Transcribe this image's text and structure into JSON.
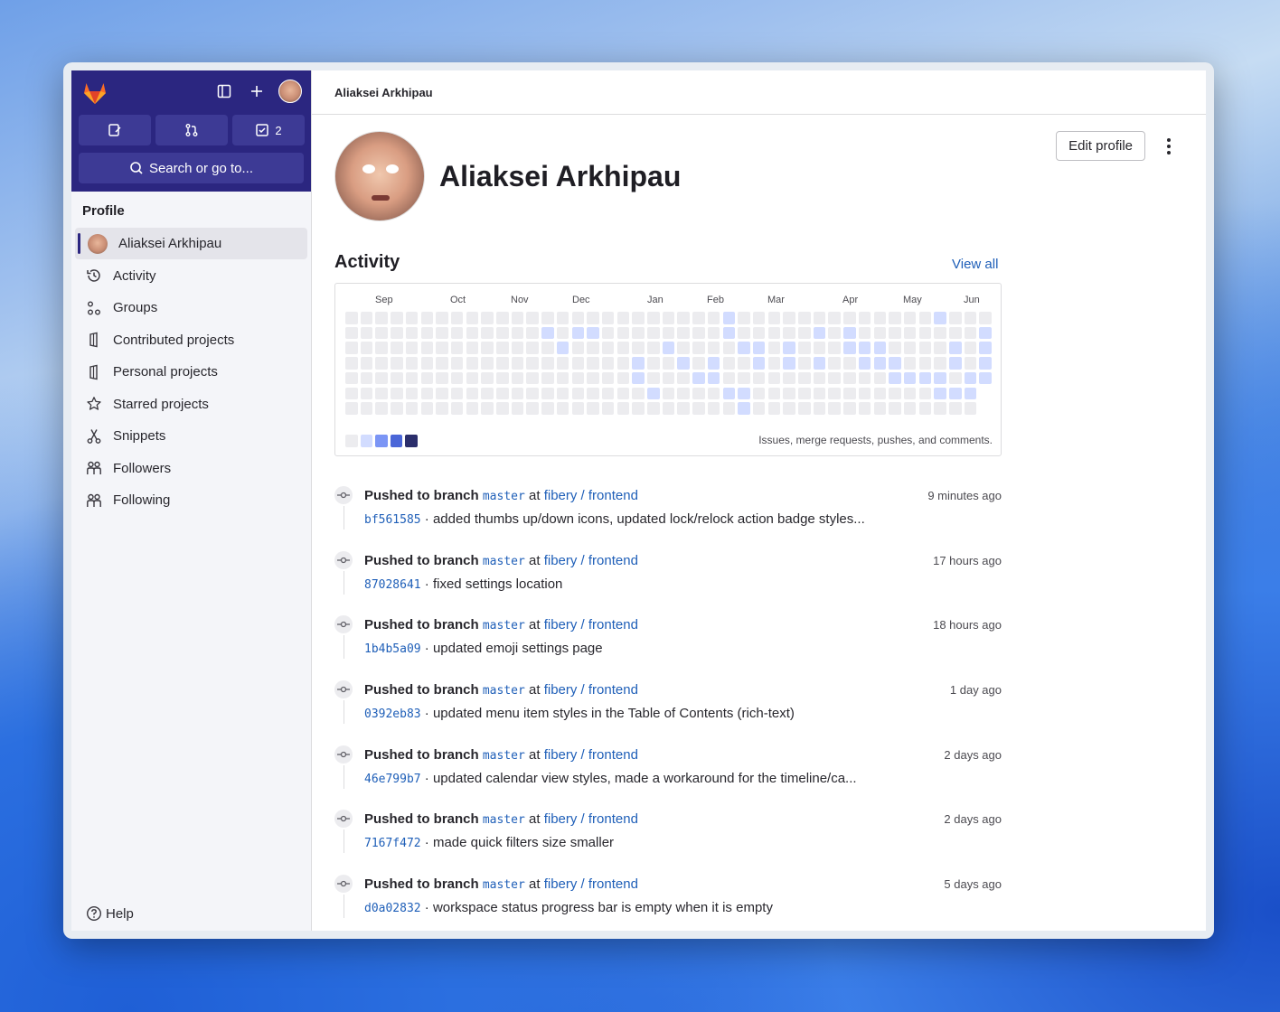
{
  "sidebar": {
    "search_label": "Search or go to...",
    "todo_count": "2",
    "heading": "Profile",
    "items": [
      {
        "label": "Aliaksei Arkhipau",
        "icon": "avatar"
      },
      {
        "label": "Activity",
        "icon": "history-icon"
      },
      {
        "label": "Groups",
        "icon": "group-icon"
      },
      {
        "label": "Contributed projects",
        "icon": "project-icon"
      },
      {
        "label": "Personal projects",
        "icon": "project-icon"
      },
      {
        "label": "Starred projects",
        "icon": "star-icon"
      },
      {
        "label": "Snippets",
        "icon": "snippet-icon"
      },
      {
        "label": "Followers",
        "icon": "users-icon"
      },
      {
        "label": "Following",
        "icon": "users-icon"
      }
    ],
    "help_label": "Help"
  },
  "header": {
    "breadcrumb": "Aliaksei Arkhipau"
  },
  "profile": {
    "name": "Aliaksei Arkhipau",
    "edit_label": "Edit profile"
  },
  "activity": {
    "title": "Activity",
    "view_all": "View all",
    "months": [
      "Sep",
      "Oct",
      "Nov",
      "Dec",
      "Jan",
      "Feb",
      "Mar",
      "Apr",
      "May",
      "Jun"
    ],
    "legend_text": "Issues, merge requests, pushes, and comments.",
    "legend_colors": [
      "#ececef",
      "#d2dcff",
      "#7b95f5",
      "#4a66d8",
      "#2b2e6b"
    ],
    "empty_color": "#ececef",
    "active_color": "#d2dcff",
    "active_cells": [
      [
        15,
        1
      ],
      [
        3,
        2
      ],
      [
        6,
        2
      ],
      [
        11,
        3
      ],
      [
        16,
        3
      ],
      [
        17,
        3
      ],
      [
        4,
        3
      ],
      [
        9,
        4
      ],
      [
        14,
        4
      ],
      [
        12,
        4
      ],
      [
        17,
        4
      ],
      [
        13,
        5
      ],
      [
        9,
        5
      ],
      [
        14,
        5
      ],
      [
        10,
        6
      ],
      [
        5,
        2
      ],
      [
        15,
        6
      ],
      [
        16,
        6
      ],
      [
        15,
        2
      ],
      [
        16,
        7
      ],
      [
        16,
        8
      ],
      [
        19,
        3
      ],
      [
        19,
        4
      ],
      [
        21,
        2
      ],
      [
        21,
        4
      ],
      [
        23,
        2
      ],
      [
        23,
        3
      ],
      [
        24,
        3
      ],
      [
        24,
        4
      ],
      [
        25,
        3
      ],
      [
        25,
        4
      ],
      [
        26,
        4
      ],
      [
        26,
        5
      ],
      [
        27,
        5
      ],
      [
        28,
        5
      ],
      [
        29,
        1
      ],
      [
        29,
        5
      ],
      [
        29,
        6
      ],
      [
        30,
        3
      ],
      [
        30,
        4
      ],
      [
        30,
        6
      ],
      [
        31,
        5
      ],
      [
        31,
        6
      ],
      [
        32,
        2
      ],
      [
        32,
        3
      ],
      [
        32,
        4
      ],
      [
        32,
        5
      ]
    ]
  },
  "events": [
    {
      "action": "Pushed to branch",
      "branch": "master",
      "at": "at",
      "project": "fibery / frontend",
      "time": "9 minutes ago",
      "sha": "bf561585",
      "message": "added thumbs up/down icons, updated lock/relock action badge styles..."
    },
    {
      "action": "Pushed to branch",
      "branch": "master",
      "at": "at",
      "project": "fibery / frontend",
      "time": "17 hours ago",
      "sha": "87028641",
      "message": "fixed settings location"
    },
    {
      "action": "Pushed to branch",
      "branch": "master",
      "at": "at",
      "project": "fibery / frontend",
      "time": "18 hours ago",
      "sha": "1b4b5a09",
      "message": "updated emoji settings page"
    },
    {
      "action": "Pushed to branch",
      "branch": "master",
      "at": "at",
      "project": "fibery / frontend",
      "time": "1 day ago",
      "sha": "0392eb83",
      "message": "updated menu item styles in the Table of Contents (rich-text)"
    },
    {
      "action": "Pushed to branch",
      "branch": "master",
      "at": "at",
      "project": "fibery / frontend",
      "time": "2 days ago",
      "sha": "46e799b7",
      "message": "updated calendar view styles, made a workaround for the timeline/ca..."
    },
    {
      "action": "Pushed to branch",
      "branch": "master",
      "at": "at",
      "project": "fibery / frontend",
      "time": "2 days ago",
      "sha": "7167f472",
      "message": "made quick filters size smaller"
    },
    {
      "action": "Pushed to branch",
      "branch": "master",
      "at": "at",
      "project": "fibery / frontend",
      "time": "5 days ago",
      "sha": "d0a02832",
      "message": "workspace status progress bar is empty when it is empty"
    }
  ],
  "colors": {
    "sidebar_top": "#2b2680",
    "link": "#1f5fb8"
  }
}
